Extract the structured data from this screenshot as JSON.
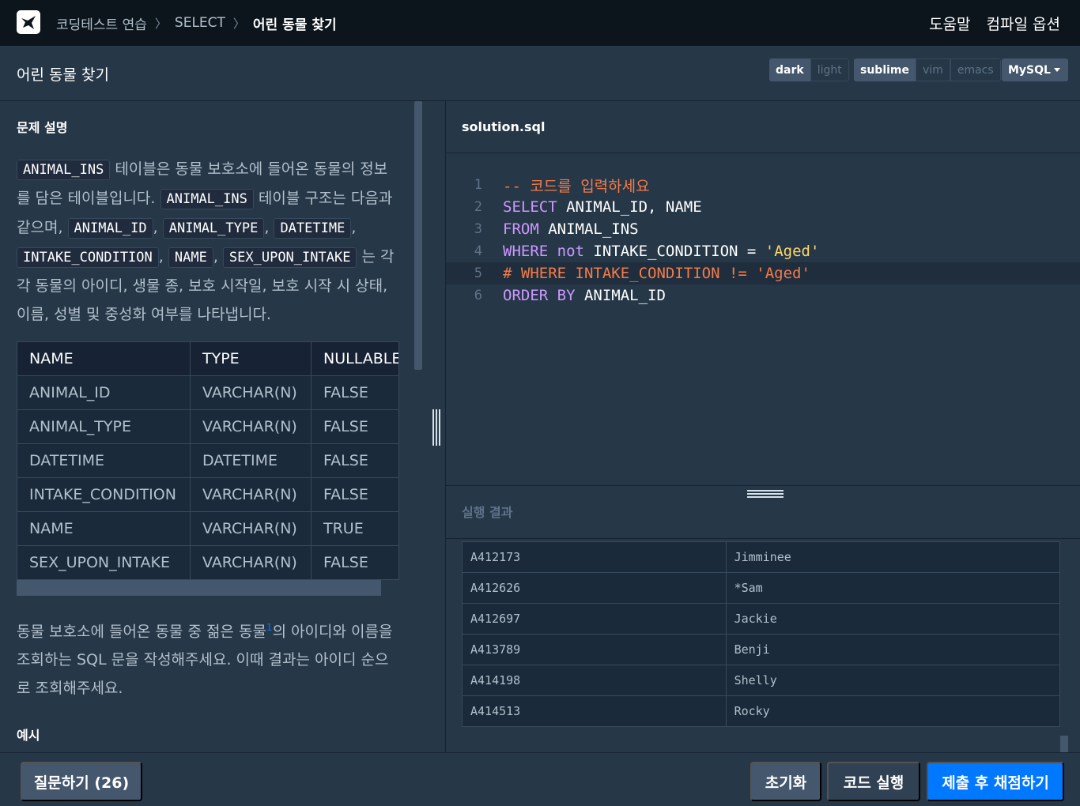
{
  "navbar": {
    "breadcrumb": [
      "코딩테스트 연습",
      "SELECT",
      "어린 동물 찾기"
    ],
    "help": "도움말",
    "compile_options": "컴파일 옵션"
  },
  "titlebar": {
    "title": "어린 동물 찾기",
    "theme": {
      "active": "dark",
      "inactive": "light"
    },
    "keymap": {
      "active": "sublime",
      "options": [
        "vim",
        "emacs"
      ]
    },
    "language": "MySQL"
  },
  "problem": {
    "section_title": "문제 설명",
    "chips": [
      "ANIMAL_INS",
      "ANIMAL_INS",
      "ANIMAL_ID",
      "ANIMAL_TYPE",
      "DATETIME",
      "INTAKE_CONDITION",
      "NAME",
      "SEX_UPON_INTAKE"
    ],
    "text1": "테이블은 동물 보호소에 들어온 동물의 정보를 담은 테이블입니다.",
    "text2": "테이블 구조는 다음과 같으며,",
    "comma": ",",
    "text3": "는 각각 동물의 아이디, 생물 종, 보호 시작일, 보호 시작 시 상태, 이름, 성별 및 중성화 여부를 나타냅니다.",
    "schema_headers": [
      "NAME",
      "TYPE",
      "NULLABLE"
    ],
    "schema_rows": [
      [
        "ANIMAL_ID",
        "VARCHAR(N)",
        "FALSE"
      ],
      [
        "ANIMAL_TYPE",
        "VARCHAR(N)",
        "FALSE"
      ],
      [
        "DATETIME",
        "DATETIME",
        "FALSE"
      ],
      [
        "INTAKE_CONDITION",
        "VARCHAR(N)",
        "FALSE"
      ],
      [
        "NAME",
        "VARCHAR(N)",
        "TRUE"
      ],
      [
        "SEX_UPON_INTAKE",
        "VARCHAR(N)",
        "FALSE"
      ]
    ],
    "task_a": "동물 보호소에 들어온 동물 중 젊은 동물",
    "task_sup": "1",
    "task_b": "의 아이디와 이름을 조회하는 SQL 문을 작성해주세요. 이때 결과는 아이디 순으로 조회해주세요.",
    "example_title": "예시"
  },
  "editor": {
    "filename": "solution.sql",
    "line_numbers": [
      "1",
      "2",
      "3",
      "4",
      "5",
      "6"
    ],
    "l1": "-- 코드를 입력하세요",
    "l2_kw": "SELECT",
    "l2_rest": " ANIMAL_ID, NAME",
    "l3_kw": "FROM",
    "l3_rest": " ANIMAL_INS",
    "l4_kw": "WHERE",
    "l4_not": "not",
    "l4_mid": " INTAKE_CONDITION = ",
    "l4_str": "'Aged'",
    "l5": "# WHERE INTAKE_CONDITION != 'Aged'",
    "l6_kw": "ORDER BY",
    "l6_rest": " ANIMAL_ID"
  },
  "result": {
    "title": "실행 결과",
    "rows": [
      [
        "A412173",
        "Jimminee"
      ],
      [
        "A412626",
        "*Sam"
      ],
      [
        "A412697",
        "Jackie"
      ],
      [
        "A413789",
        "Benji"
      ],
      [
        "A414198",
        "Shelly"
      ],
      [
        "A414513",
        "Rocky"
      ]
    ]
  },
  "footer": {
    "question": "질문하기 (26)",
    "reset": "초기화",
    "run": "코드 실행",
    "submit": "제출 후 채점하기"
  },
  "colors": {
    "accent": "#0078ff",
    "keyword": "#cc99ff",
    "string": "#ffd866",
    "comment": "#f47c4a"
  }
}
